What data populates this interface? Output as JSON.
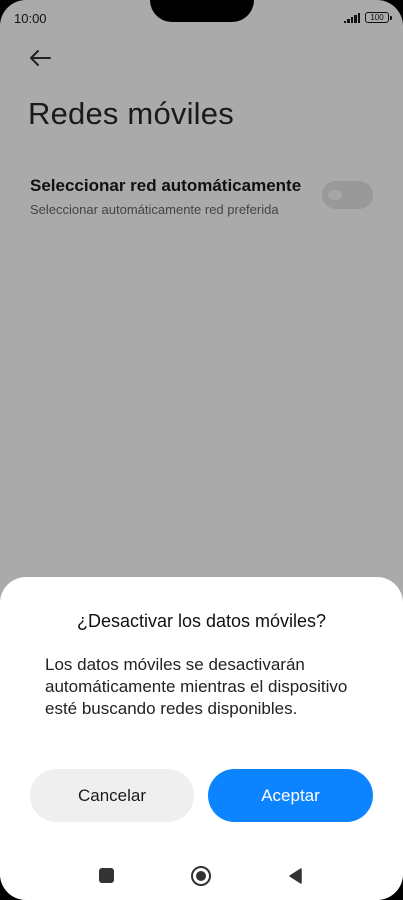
{
  "status_bar": {
    "time": "10:00",
    "battery": "100"
  },
  "header": {
    "title": "Redes móviles"
  },
  "settings": {
    "auto_network": {
      "title": "Seleccionar red automáticamente",
      "subtitle": "Seleccionar automáticamente red preferida",
      "enabled": false
    }
  },
  "dialog": {
    "title": "¿Desactivar los datos móviles?",
    "message": "Los datos móviles se desactivarán automáticamente mientras el dispositivo esté buscando redes disponibles.",
    "cancel_label": "Cancelar",
    "accept_label": "Aceptar"
  },
  "icons": {
    "back": "arrow-left-icon",
    "signal": "signal-icon",
    "battery": "battery-icon",
    "recents": "square-icon",
    "home": "circle-icon",
    "nav_back": "triangle-back-icon"
  },
  "colors": {
    "accent": "#0d84ff",
    "scrim": "#aaaaaa",
    "sheet": "#ffffff",
    "cancel_bg": "#efefef"
  }
}
